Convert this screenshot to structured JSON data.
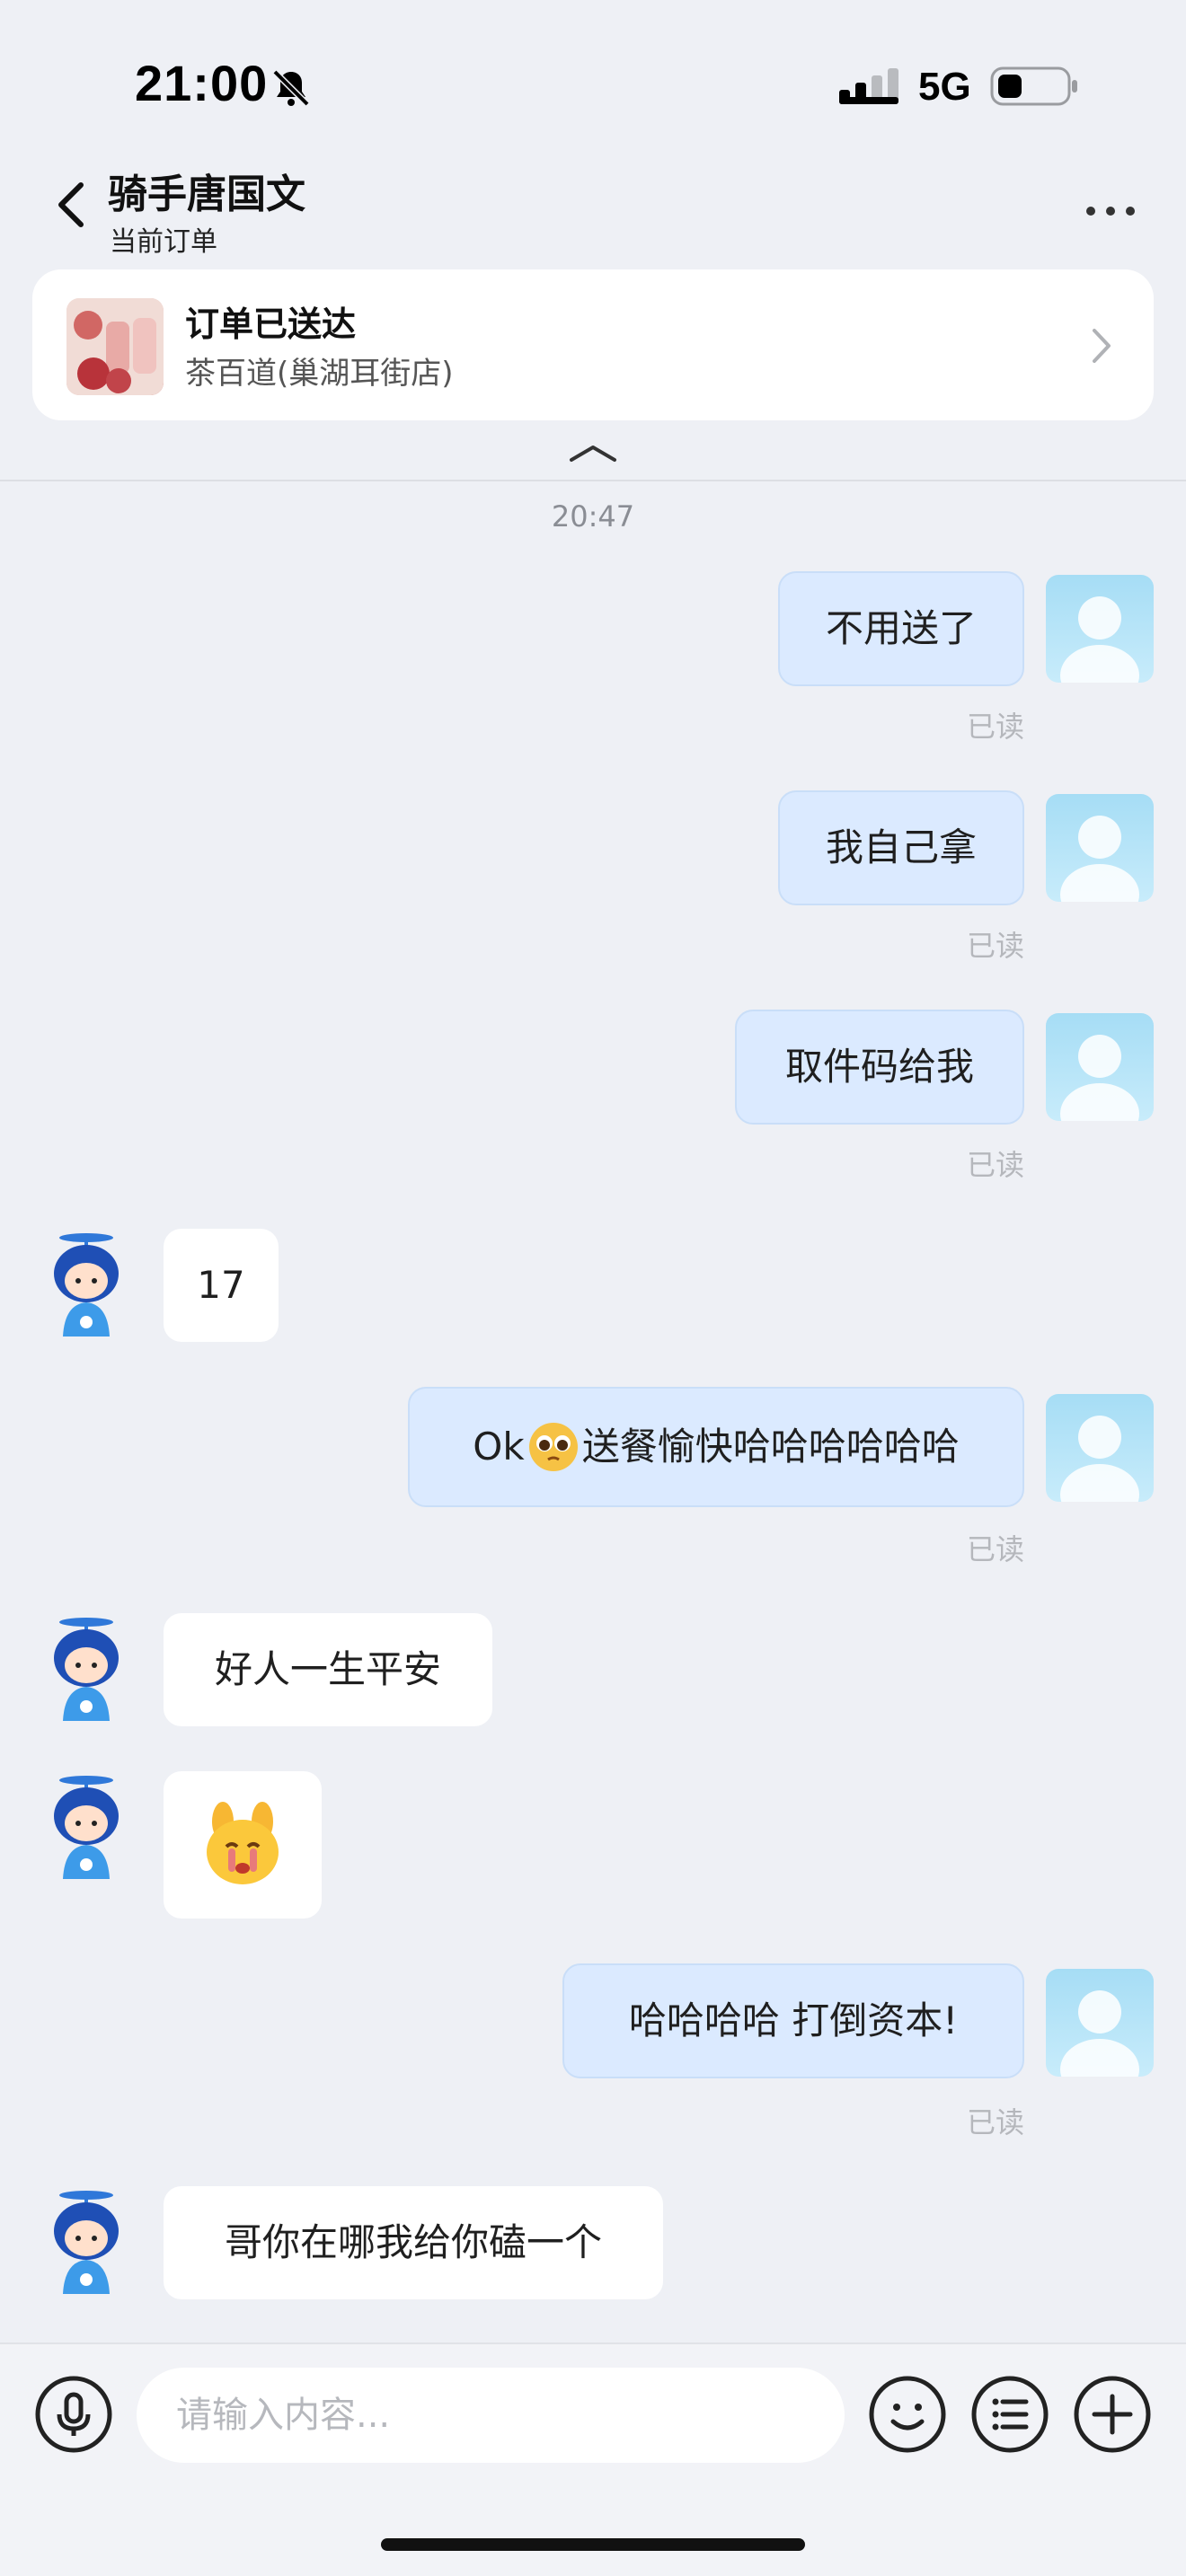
{
  "status_bar": {
    "time": "21:00",
    "network": "5G"
  },
  "header": {
    "title": "骑手唐国文",
    "subtitle": "当前订单"
  },
  "order": {
    "status": "订单已送达",
    "store": "茶百道(巢湖耳街店)"
  },
  "timestamp": "20:47",
  "messages": [
    {
      "side": "out",
      "text": "不用送了",
      "read": "已读"
    },
    {
      "side": "out",
      "text": "我自己拿",
      "read": "已读"
    },
    {
      "side": "out",
      "text": "取件码给我",
      "read": "已读"
    },
    {
      "side": "in",
      "text": "17"
    },
    {
      "side": "out",
      "text_before": "Ok",
      "text_after": "送餐愉快哈哈哈哈哈哈",
      "read": "已读"
    },
    {
      "side": "in",
      "text": "好人一生平安"
    },
    {
      "side": "in",
      "sticker": "crying-face-sticker"
    },
    {
      "side": "out",
      "text": "哈哈哈哈  打倒资本!",
      "read": "已读"
    },
    {
      "side": "in",
      "text": "哥你在哪我给你磕一个"
    }
  ],
  "input": {
    "placeholder": "请输入内容..."
  },
  "icons": {
    "back": "chevron-left-icon",
    "more": "more-dots-icon",
    "mic": "microphone-icon",
    "emoji": "emoji-face-icon",
    "menu": "list-menu-icon",
    "add": "plus-icon"
  },
  "colors": {
    "background": "#eef0f5",
    "outgoing_bubble": "#dbeaff",
    "incoming_bubble": "#ffffff",
    "read_text": "#b5b7bc"
  }
}
